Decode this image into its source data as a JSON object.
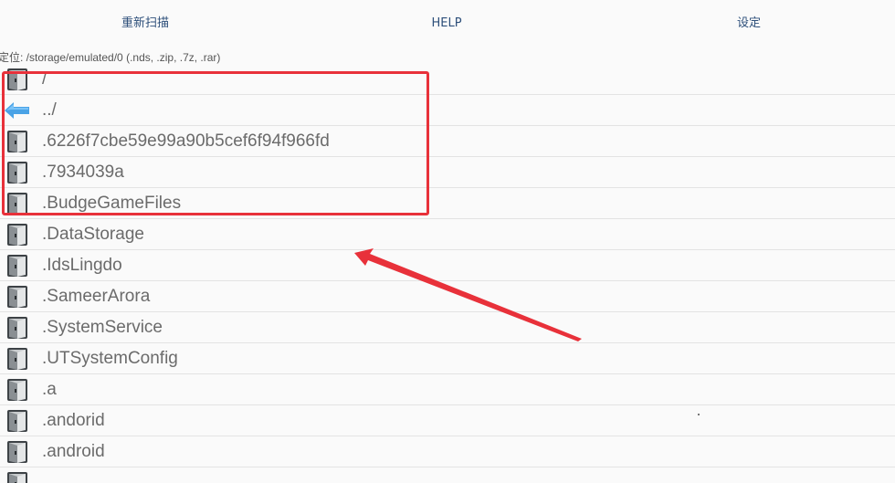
{
  "toolbar": {
    "rescan_label": "重新扫描",
    "help_label": "HELP",
    "settings_label": "设定"
  },
  "location": {
    "path_text": "定位: /storage/emulated/0 (.nds, .zip, .7z, .rar)"
  },
  "files": [
    {
      "name": "/",
      "icon": "folder-icon"
    },
    {
      "name": "../",
      "icon": "back-arrow-icon"
    },
    {
      "name": ".6226f7cbe59e99a90b5cef6f94f966fd",
      "icon": "folder-icon"
    },
    {
      "name": ".7934039a",
      "icon": "folder-icon"
    },
    {
      "name": ".BudgeGameFiles",
      "icon": "folder-icon"
    },
    {
      "name": ".DataStorage",
      "icon": "folder-icon"
    },
    {
      "name": ".IdsLingdo",
      "icon": "folder-icon"
    },
    {
      "name": ".SameerArora",
      "icon": "folder-icon"
    },
    {
      "name": ".SystemService",
      "icon": "folder-icon"
    },
    {
      "name": ".UTSystemConfig",
      "icon": "folder-icon"
    },
    {
      "name": ".a",
      "icon": "folder-icon"
    },
    {
      "name": ".andorid",
      "icon": "folder-icon"
    },
    {
      "name": ".android",
      "icon": "folder-icon"
    },
    {
      "name": "",
      "icon": "folder-icon"
    }
  ],
  "colors": {
    "highlight": "#e8313a",
    "toolbar_text": "#2d4f7a",
    "file_text": "#6b6b6b",
    "back_arrow": "#4aa3e6"
  }
}
